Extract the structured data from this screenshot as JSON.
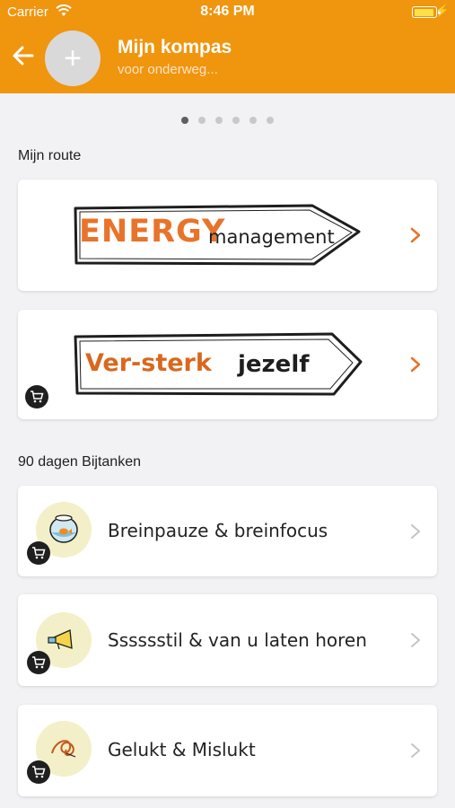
{
  "status_bar": {
    "carrier": "Carrier",
    "time": "8:46 PM",
    "battery_icon": "battery-charging-icon"
  },
  "header": {
    "background_color": "#f0950e",
    "back_icon": "arrow-left-icon",
    "avatar_icon": "plus-icon",
    "title": "Mijn kompas",
    "subtitle": "voor onderweg..."
  },
  "page_indicator": {
    "count": 6,
    "active_index": 0
  },
  "sections": {
    "route_title": "Mijn route",
    "bijtanken_title": "90 dagen Bijtanken"
  },
  "route_cards": [
    {
      "sign_part1": "ENERGY",
      "sign_part2": "management",
      "accent_color": "#e8732a",
      "has_cart": false
    },
    {
      "sign_part1": "Ver-sterk",
      "sign_part2": "jezelf",
      "accent_color": "#d8681f",
      "has_cart": true
    }
  ],
  "bijtanken_items": [
    {
      "label": "Breinpauze & breinfocus",
      "icon": "fishbowl-icon",
      "has_cart": true
    },
    {
      "label": "Sssssstil & van u laten horen",
      "icon": "megaphone-icon",
      "has_cart": true
    },
    {
      "label": "Gelukt & Mislukt",
      "icon": "tangle-icon",
      "has_cart": true
    }
  ]
}
